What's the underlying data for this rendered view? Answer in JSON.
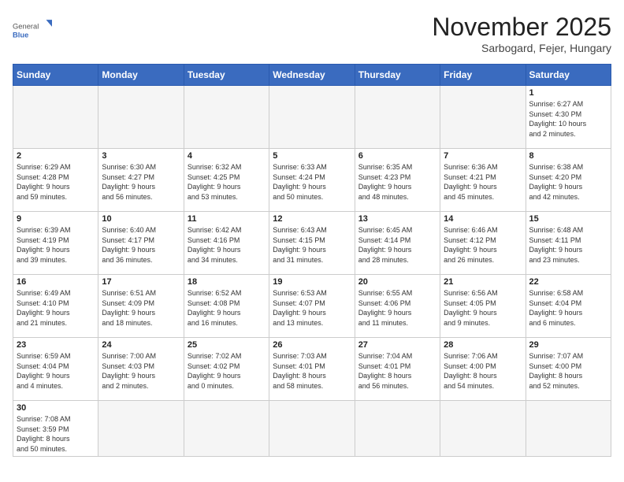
{
  "logo": {
    "text_general": "General",
    "text_blue": "Blue"
  },
  "title": "November 2025",
  "subtitle": "Sarbogard, Fejer, Hungary",
  "days_header": [
    "Sunday",
    "Monday",
    "Tuesday",
    "Wednesday",
    "Thursday",
    "Friday",
    "Saturday"
  ],
  "weeks": [
    [
      {
        "day": "",
        "info": ""
      },
      {
        "day": "",
        "info": ""
      },
      {
        "day": "",
        "info": ""
      },
      {
        "day": "",
        "info": ""
      },
      {
        "day": "",
        "info": ""
      },
      {
        "day": "",
        "info": ""
      },
      {
        "day": "1",
        "info": "Sunrise: 6:27 AM\nSunset: 4:30 PM\nDaylight: 10 hours\nand 2 minutes."
      }
    ],
    [
      {
        "day": "2",
        "info": "Sunrise: 6:29 AM\nSunset: 4:28 PM\nDaylight: 9 hours\nand 59 minutes."
      },
      {
        "day": "3",
        "info": "Sunrise: 6:30 AM\nSunset: 4:27 PM\nDaylight: 9 hours\nand 56 minutes."
      },
      {
        "day": "4",
        "info": "Sunrise: 6:32 AM\nSunset: 4:25 PM\nDaylight: 9 hours\nand 53 minutes."
      },
      {
        "day": "5",
        "info": "Sunrise: 6:33 AM\nSunset: 4:24 PM\nDaylight: 9 hours\nand 50 minutes."
      },
      {
        "day": "6",
        "info": "Sunrise: 6:35 AM\nSunset: 4:23 PM\nDaylight: 9 hours\nand 48 minutes."
      },
      {
        "day": "7",
        "info": "Sunrise: 6:36 AM\nSunset: 4:21 PM\nDaylight: 9 hours\nand 45 minutes."
      },
      {
        "day": "8",
        "info": "Sunrise: 6:38 AM\nSunset: 4:20 PM\nDaylight: 9 hours\nand 42 minutes."
      }
    ],
    [
      {
        "day": "9",
        "info": "Sunrise: 6:39 AM\nSunset: 4:19 PM\nDaylight: 9 hours\nand 39 minutes."
      },
      {
        "day": "10",
        "info": "Sunrise: 6:40 AM\nSunset: 4:17 PM\nDaylight: 9 hours\nand 36 minutes."
      },
      {
        "day": "11",
        "info": "Sunrise: 6:42 AM\nSunset: 4:16 PM\nDaylight: 9 hours\nand 34 minutes."
      },
      {
        "day": "12",
        "info": "Sunrise: 6:43 AM\nSunset: 4:15 PM\nDaylight: 9 hours\nand 31 minutes."
      },
      {
        "day": "13",
        "info": "Sunrise: 6:45 AM\nSunset: 4:14 PM\nDaylight: 9 hours\nand 28 minutes."
      },
      {
        "day": "14",
        "info": "Sunrise: 6:46 AM\nSunset: 4:12 PM\nDaylight: 9 hours\nand 26 minutes."
      },
      {
        "day": "15",
        "info": "Sunrise: 6:48 AM\nSunset: 4:11 PM\nDaylight: 9 hours\nand 23 minutes."
      }
    ],
    [
      {
        "day": "16",
        "info": "Sunrise: 6:49 AM\nSunset: 4:10 PM\nDaylight: 9 hours\nand 21 minutes."
      },
      {
        "day": "17",
        "info": "Sunrise: 6:51 AM\nSunset: 4:09 PM\nDaylight: 9 hours\nand 18 minutes."
      },
      {
        "day": "18",
        "info": "Sunrise: 6:52 AM\nSunset: 4:08 PM\nDaylight: 9 hours\nand 16 minutes."
      },
      {
        "day": "19",
        "info": "Sunrise: 6:53 AM\nSunset: 4:07 PM\nDaylight: 9 hours\nand 13 minutes."
      },
      {
        "day": "20",
        "info": "Sunrise: 6:55 AM\nSunset: 4:06 PM\nDaylight: 9 hours\nand 11 minutes."
      },
      {
        "day": "21",
        "info": "Sunrise: 6:56 AM\nSunset: 4:05 PM\nDaylight: 9 hours\nand 9 minutes."
      },
      {
        "day": "22",
        "info": "Sunrise: 6:58 AM\nSunset: 4:04 PM\nDaylight: 9 hours\nand 6 minutes."
      }
    ],
    [
      {
        "day": "23",
        "info": "Sunrise: 6:59 AM\nSunset: 4:04 PM\nDaylight: 9 hours\nand 4 minutes."
      },
      {
        "day": "24",
        "info": "Sunrise: 7:00 AM\nSunset: 4:03 PM\nDaylight: 9 hours\nand 2 minutes."
      },
      {
        "day": "25",
        "info": "Sunrise: 7:02 AM\nSunset: 4:02 PM\nDaylight: 9 hours\nand 0 minutes."
      },
      {
        "day": "26",
        "info": "Sunrise: 7:03 AM\nSunset: 4:01 PM\nDaylight: 8 hours\nand 58 minutes."
      },
      {
        "day": "27",
        "info": "Sunrise: 7:04 AM\nSunset: 4:01 PM\nDaylight: 8 hours\nand 56 minutes."
      },
      {
        "day": "28",
        "info": "Sunrise: 7:06 AM\nSunset: 4:00 PM\nDaylight: 8 hours\nand 54 minutes."
      },
      {
        "day": "29",
        "info": "Sunrise: 7:07 AM\nSunset: 4:00 PM\nDaylight: 8 hours\nand 52 minutes."
      }
    ],
    [
      {
        "day": "30",
        "info": "Sunrise: 7:08 AM\nSunset: 3:59 PM\nDaylight: 8 hours\nand 50 minutes."
      },
      {
        "day": "",
        "info": ""
      },
      {
        "day": "",
        "info": ""
      },
      {
        "day": "",
        "info": ""
      },
      {
        "day": "",
        "info": ""
      },
      {
        "day": "",
        "info": ""
      },
      {
        "day": "",
        "info": ""
      }
    ]
  ]
}
